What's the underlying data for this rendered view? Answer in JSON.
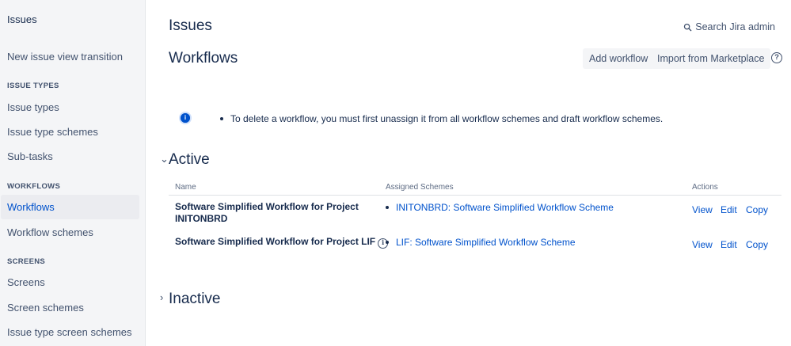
{
  "sidebar": {
    "title": "Issues",
    "items": [
      {
        "label": "New issue view transition"
      },
      {
        "section": "ISSUE TYPES"
      },
      {
        "label": "Issue types"
      },
      {
        "label": "Issue type schemes"
      },
      {
        "label": "Sub-tasks"
      },
      {
        "section": "WORKFLOWS"
      },
      {
        "label": "Workflows",
        "active": true
      },
      {
        "label": "Workflow schemes"
      },
      {
        "section": "SCREENS"
      },
      {
        "label": "Screens"
      },
      {
        "label": "Screen schemes"
      },
      {
        "label": "Issue type screen schemes"
      }
    ]
  },
  "header": {
    "breadcrumb": "Issues",
    "search_label": "Search Jira admin",
    "title": "Workflows",
    "add_workflow_label": "Add workflow",
    "import_label": "Import from Marketplace",
    "help_symbol": "?"
  },
  "info": {
    "icon_symbol": "i",
    "message": "To delete a workflow, you must first unassign it from all workflow schemes and draft workflow schemes."
  },
  "active": {
    "toggle": "⌄",
    "title": "Active",
    "columns": [
      "Name",
      "Assigned Schemes",
      "Actions"
    ],
    "rows": [
      {
        "name_line1": "Software Simplified Workflow for Project",
        "name_line2": "INITONBRD",
        "scheme": "INITONBRD: Software Simplified Workflow Scheme",
        "actions": [
          "View",
          "Edit",
          "Copy"
        ]
      },
      {
        "name_line1": "Software Simplified Workflow for Project LIF",
        "name_line2": "",
        "scheme": "LIF: Software Simplified Workflow Scheme",
        "actions": [
          "View",
          "Edit",
          "Copy"
        ],
        "info_symbol": "i"
      }
    ]
  },
  "inactive": {
    "toggle": "›",
    "title": "Inactive"
  },
  "colors": {
    "link": "#0052cc",
    "text": "#172b4d",
    "sidebar_bg": "#f4f5f7",
    "active_item_bg": "#ebecf0"
  }
}
